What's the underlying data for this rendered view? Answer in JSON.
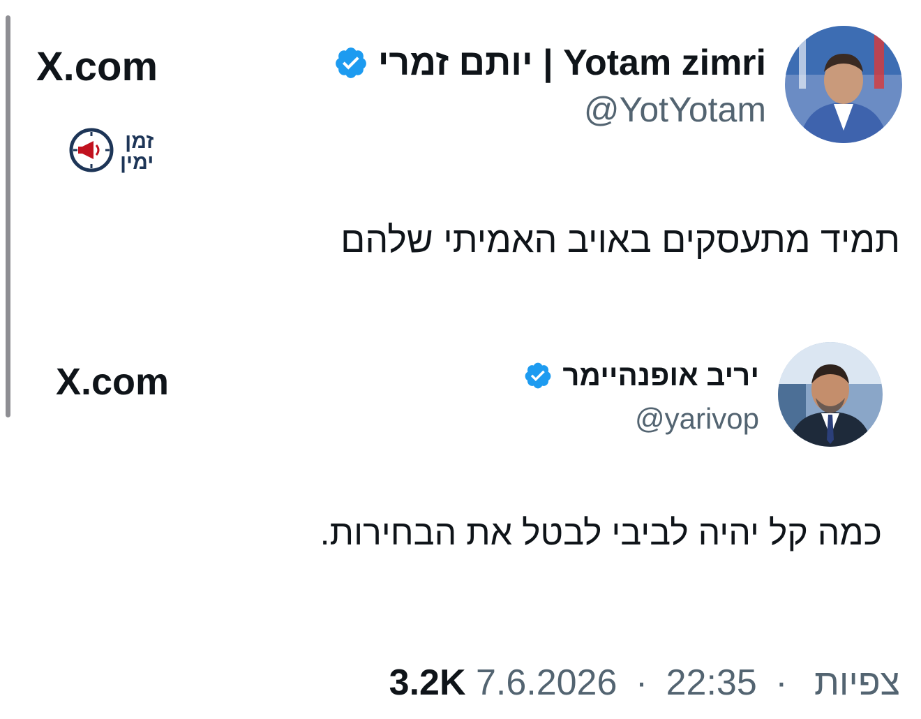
{
  "tweet": {
    "author": {
      "name": "יותם זמרי | Yotam zimri",
      "handle": "@YotYotam"
    },
    "text": "תמיד מתעסקים באויב האמיתי שלהם",
    "source_label": "X.com",
    "brand": {
      "line1": "זמן",
      "line2": "ימין"
    }
  },
  "quoted": {
    "author": {
      "name": "יריב אופנהיימר",
      "handle": "@yarivop"
    },
    "text": "כמה קל יהיה לביבי לבטל את הבחירות.",
    "source_label": "X.com"
  },
  "meta": {
    "date": "7.6.2026",
    "time": "22:35",
    "views_label": "צפיות",
    "views_count": "3.2K",
    "separator": "·"
  },
  "colors": {
    "verified": "#1d9bf0",
    "secondary_text": "#536471",
    "brand_navy": "#1d3557",
    "brand_red": "#c1121f"
  },
  "icons": [
    "verified-badge-icon",
    "x-logo-icon",
    "megaphone-clock-icon",
    "avatar"
  ]
}
